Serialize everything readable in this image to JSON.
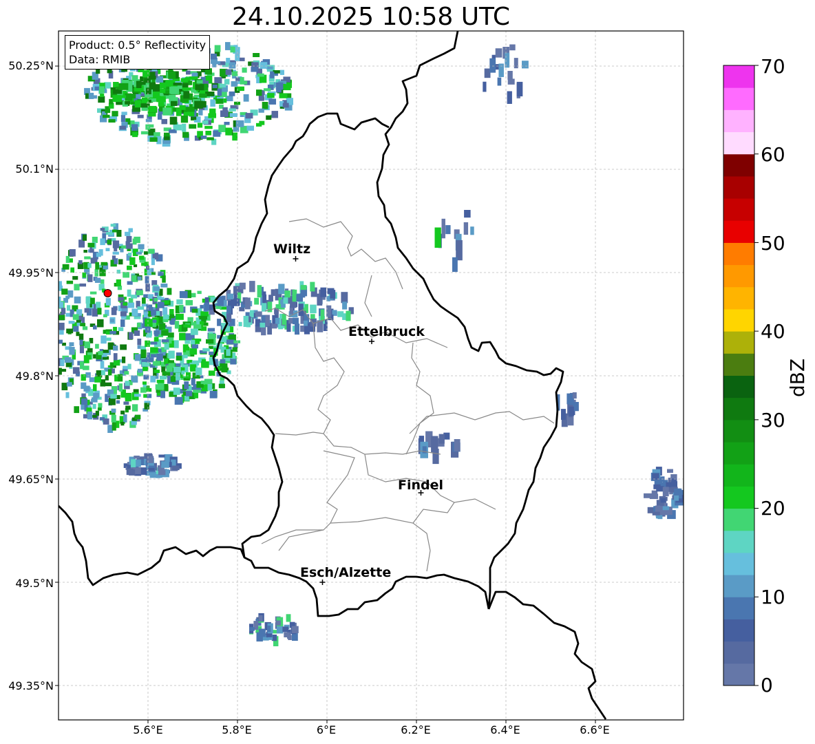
{
  "title": "24.10.2025 10:58 UTC",
  "info": {
    "product": "Product: 0.5° Reflectivity",
    "data": "Data: RMIB"
  },
  "axes": {
    "lat_labels": [
      "50.25°N",
      "50.1°N",
      "49.95°N",
      "49.8°N",
      "49.65°N",
      "49.5°N",
      "49.35°N"
    ],
    "lon_labels": [
      "5.6°E",
      "5.8°E",
      "6°E",
      "6.2°E",
      "6.4°E",
      "6.6°E"
    ],
    "gridlines": true
  },
  "cities": [
    {
      "name": "Wiltz",
      "lon": 5.93,
      "lat": 49.97
    },
    {
      "name": "Ettelbruck",
      "lon": 6.1,
      "lat": 49.85
    },
    {
      "name": "Findel",
      "lon": 6.21,
      "lat": 49.63
    },
    {
      "name": "Esch/Alzette",
      "lon": 5.99,
      "lat": 49.5
    }
  ],
  "radar_site": {
    "lon": 5.51,
    "lat": 49.92,
    "color": "#ff0000"
  },
  "colorbar": {
    "label": "dBZ",
    "ticks": [
      "0",
      "10",
      "20",
      "30",
      "40",
      "50",
      "60",
      "70"
    ],
    "min": 0,
    "max": 70,
    "step": 2.5,
    "colors": [
      "#6577a8",
      "#566aa0",
      "#455f9f",
      "#4a76b0",
      "#5a9bc6",
      "#66bfdd",
      "#5ed5c3",
      "#41d673",
      "#14c81f",
      "#12b51b",
      "#12a116",
      "#128e13",
      "#0f7a10",
      "#0a6310",
      "#4b7d10",
      "#adb109",
      "#ffd500",
      "#ffb400",
      "#ff9900",
      "#ff7c00",
      "#e80000",
      "#c70000",
      "#a80000",
      "#7f0000",
      "#ffdbff",
      "#ffb2ff",
      "#ff6bff",
      "#ee34ee"
    ]
  }
}
